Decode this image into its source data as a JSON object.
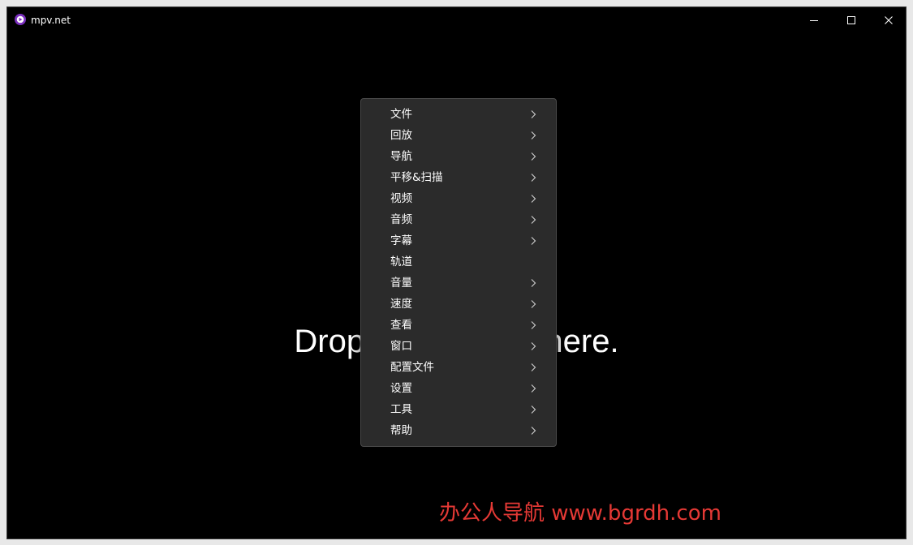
{
  "window": {
    "title": "mpv.net"
  },
  "main": {
    "drop_text": "Drop files to play here."
  },
  "context_menu": {
    "items": [
      {
        "label": "文件",
        "submenu": true
      },
      {
        "label": "回放",
        "submenu": true
      },
      {
        "label": "导航",
        "submenu": true
      },
      {
        "label": "平移&扫描",
        "submenu": true
      },
      {
        "label": "视频",
        "submenu": true
      },
      {
        "label": "音频",
        "submenu": true
      },
      {
        "label": "字幕",
        "submenu": true
      },
      {
        "label": "轨道",
        "submenu": false
      },
      {
        "label": "音量",
        "submenu": true
      },
      {
        "label": "速度",
        "submenu": true
      },
      {
        "label": "查看",
        "submenu": true
      },
      {
        "label": "窗口",
        "submenu": true
      },
      {
        "label": "配置文件",
        "submenu": true
      },
      {
        "label": "设置",
        "submenu": true
      },
      {
        "label": "工具",
        "submenu": true
      },
      {
        "label": "帮助",
        "submenu": true
      }
    ]
  },
  "watermark": {
    "text": "办公人导航 www.bgrdh.com",
    "color": "#e53935"
  },
  "colors": {
    "background": "#000000",
    "menu_background": "#2b2b2b",
    "app_icon": "#7b2fbe",
    "text": "#ffffff"
  },
  "icons": {
    "app": "mpv-play-icon",
    "minimize": "minimize-icon",
    "maximize": "maximize-icon",
    "close": "close-icon",
    "submenu": "chevron-right-icon"
  }
}
